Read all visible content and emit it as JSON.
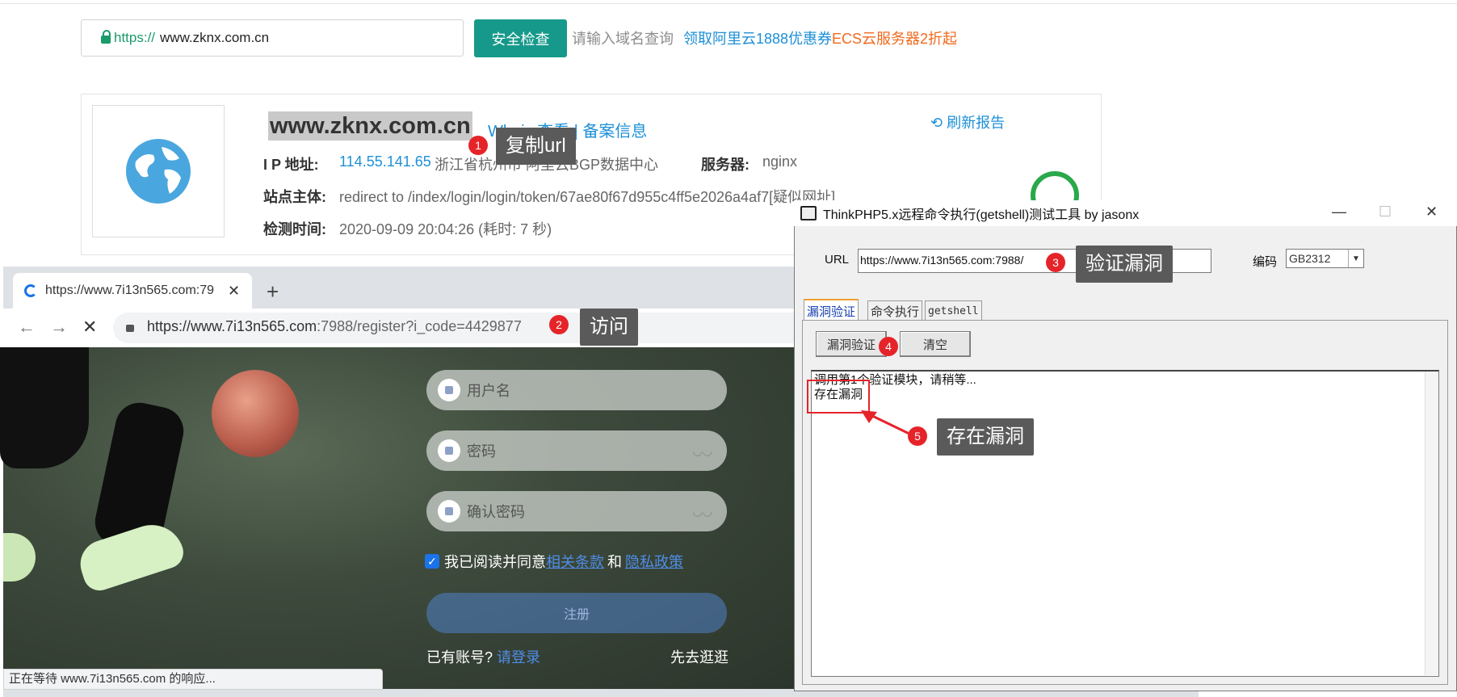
{
  "checker": {
    "url_scheme": "https://",
    "url_host": "www.zknx.com.cn",
    "check_button": "安全检查",
    "hint": "请输入域名查询",
    "promo1": "领取阿里云1888优惠券",
    "promo2": "ECS云服务器2折起"
  },
  "report": {
    "site_name": "www.zknx.com.cn",
    "whois": "Whois 查看 | 备案信息",
    "refresh": "刷新报告",
    "ip_label": "I P   地址:",
    "ip_value": "114.55.141.65",
    "ip_location": "浙江省杭州市 阿里云BGP数据中心",
    "server_label": "服务器:",
    "server_value": "nginx",
    "subject_label": "站点主体:",
    "subject_value": "redirect to /index/login/login/token/67ae80f67d955c4ff5e2026a4af7[疑似网址]",
    "time_label": "检测时间:",
    "time_value": "2020-09-09 20:04:26 (耗时: 7 秒)"
  },
  "annotations": {
    "step1_num": "1",
    "step1_text": "复制url",
    "step2_num": "2",
    "step2_text": "访问",
    "step3_num": "3",
    "step3_text": "验证漏洞",
    "step4_num": "4",
    "step5_num": "5",
    "step5_text": "存在漏洞"
  },
  "browser": {
    "tab_title": "https://www.7i13n565.com:79",
    "address_main": "https://www.7i13n565.com",
    "address_rest": ":7988/register?i_code=4429877",
    "status": "正在等待 www.7i13n565.com 的响应..."
  },
  "register_form": {
    "username_placeholder": "用户名",
    "password_placeholder": "密码",
    "confirm_placeholder": "确认密码",
    "agree_prefix": "我已阅读并同意",
    "terms_link": "相关条款",
    "and": "和",
    "privacy_link": "隐私政策",
    "register_button": "注册",
    "have_account": "已有账号?",
    "login_link": "请登录",
    "stroll": "先去逛逛"
  },
  "tool": {
    "title": "ThinkPHP5.x远程命令执行(getshell)测试工具  by jasonx",
    "url_label": "URL",
    "url_value": "https://www.7i13n565.com:7988/",
    "encoding_label": "编码",
    "encoding_value": "GB2312",
    "tabs": [
      "漏洞验证",
      "命令执行",
      "getshell"
    ],
    "verify_button": "漏洞验证",
    "clear_button": "清空",
    "output_line1": "调用第1个验证模块，请稍等...",
    "output_line2": "存在漏洞"
  },
  "colors": {
    "accent": "#16998a",
    "link": "#1e90d6",
    "promo_orange": "#f06a1d",
    "badge_red": "#e5242a"
  }
}
